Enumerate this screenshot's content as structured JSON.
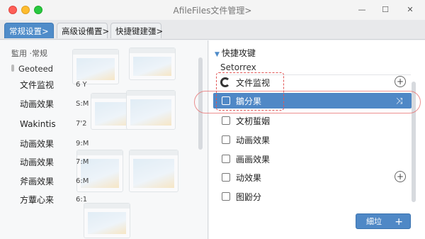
{
  "window": {
    "title": "AfileFiles文件管理",
    "title_chevron": ">",
    "controls": {
      "minimize": "—",
      "maximize": "☐",
      "close": "✕"
    }
  },
  "tabs": [
    {
      "label": "常规设置",
      "chevron": ">",
      "active": true
    },
    {
      "label": "高级设備置",
      "chevron": ">",
      "active": false
    },
    {
      "label": "快捷键建彊",
      "chevron": ">",
      "active": false
    }
  ],
  "left": {
    "section_label": "監用 ·常规",
    "group_label": "Geoteed",
    "rows": [
      {
        "label": "文件监视",
        "value": "6 Y"
      },
      {
        "label": "动画效果",
        "value": "S:M"
      },
      {
        "label": "Wakintis",
        "value": "7'2"
      },
      {
        "label": "动画效果",
        "value": "9:M"
      },
      {
        "label": "动画效果",
        "value": "7:M"
      },
      {
        "label": "斧画效果",
        "value": "6:M"
      },
      {
        "label": "方蕈心来",
        "value": "6:1"
      }
    ]
  },
  "right": {
    "header": "快捷攻键",
    "subheader": "Setorrex",
    "items": [
      {
        "label": "文件监视",
        "state": "loading"
      },
      {
        "label": "鶵分果",
        "state": "selected"
      },
      {
        "label": "文杒蜇姻",
        "state": "normal"
      },
      {
        "label": "动画效果",
        "state": "normal"
      },
      {
        "label": "画画效果",
        "state": "normal"
      },
      {
        "label": "动效果",
        "state": "normal"
      },
      {
        "label": "图鼢分",
        "state": "normal"
      }
    ],
    "add_button": {
      "label": "細垃",
      "icon": "+"
    },
    "plus_icon": "+",
    "drag_handle": "⤨"
  },
  "colors": {
    "accent": "#4f88c6",
    "annotation": "#e25555"
  }
}
